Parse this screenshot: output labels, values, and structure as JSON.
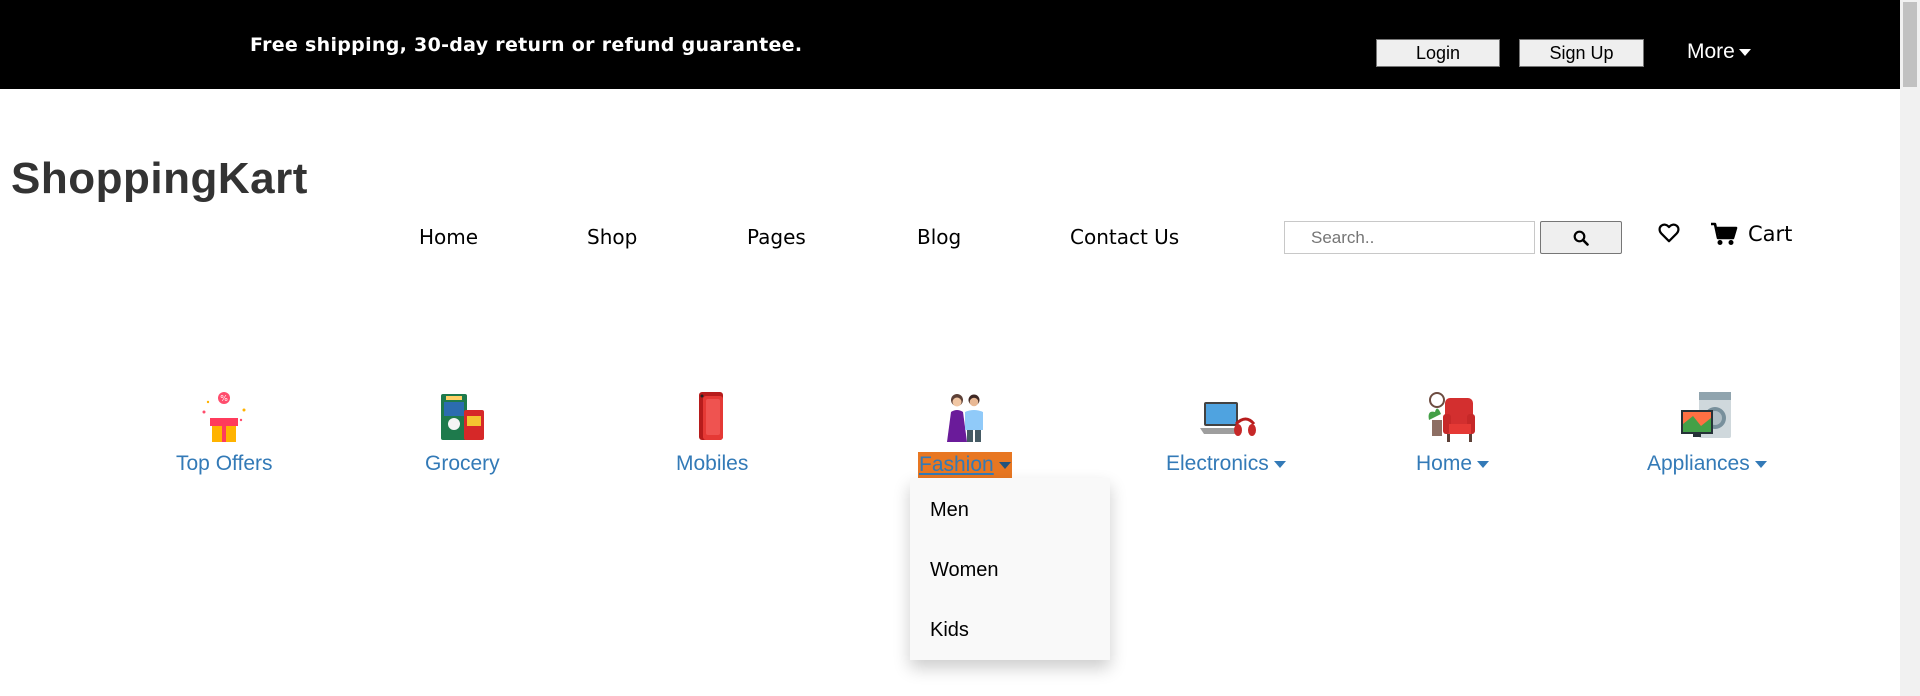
{
  "topbar": {
    "message": "Free shipping, 30-day return or refund guarantee.",
    "login_label": "Login",
    "signup_label": "Sign Up",
    "more_label": "More",
    "background": "#000000"
  },
  "brand": {
    "name": "ShoppingKart"
  },
  "nav": {
    "items": [
      {
        "label": "Home"
      },
      {
        "label": "Shop"
      },
      {
        "label": "Pages"
      },
      {
        "label": "Blog"
      },
      {
        "label": "Contact Us"
      }
    ],
    "search_placeholder": "Search..",
    "search_icon": "search-icon",
    "wishlist_icon": "heart-icon",
    "cart_icon": "cart-icon",
    "cart_label": "Cart"
  },
  "categories": [
    {
      "label": "Top Offers",
      "icon": "gift-icon",
      "has_dropdown": false
    },
    {
      "label": "Grocery",
      "icon": "grocery-icon",
      "has_dropdown": false
    },
    {
      "label": "Mobiles",
      "icon": "mobile-phone-icon",
      "has_dropdown": false
    },
    {
      "label": "Fashion",
      "icon": "fashion-people-icon",
      "has_dropdown": true,
      "active": true
    },
    {
      "label": "Electronics",
      "icon": "laptop-icon",
      "has_dropdown": true
    },
    {
      "label": "Home",
      "icon": "armchair-icon",
      "has_dropdown": true
    },
    {
      "label": "Appliances",
      "icon": "appliances-icon",
      "has_dropdown": true
    }
  ],
  "fashion_dropdown": {
    "items": [
      {
        "label": "Men"
      },
      {
        "label": "Women"
      },
      {
        "label": "Kids"
      }
    ]
  },
  "colors": {
    "link": "#337ab7",
    "active_highlight": "#e87722",
    "logo": "#333333"
  }
}
